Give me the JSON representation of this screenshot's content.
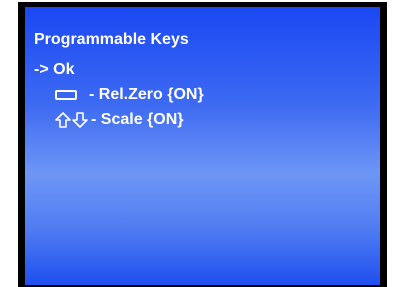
{
  "screen": {
    "title": "Programmable Keys",
    "selection": "-> Ok",
    "items": [
      {
        "icon": "rectangle-key-icon",
        "label": "- Rel.Zero {ON}"
      },
      {
        "icon": "up-down-arrow-icon",
        "label": "- Scale {ON}"
      }
    ]
  },
  "colors": {
    "panel_top": "#1a48f2",
    "panel_mid": "#6e96f6",
    "text": "#ffffff"
  }
}
